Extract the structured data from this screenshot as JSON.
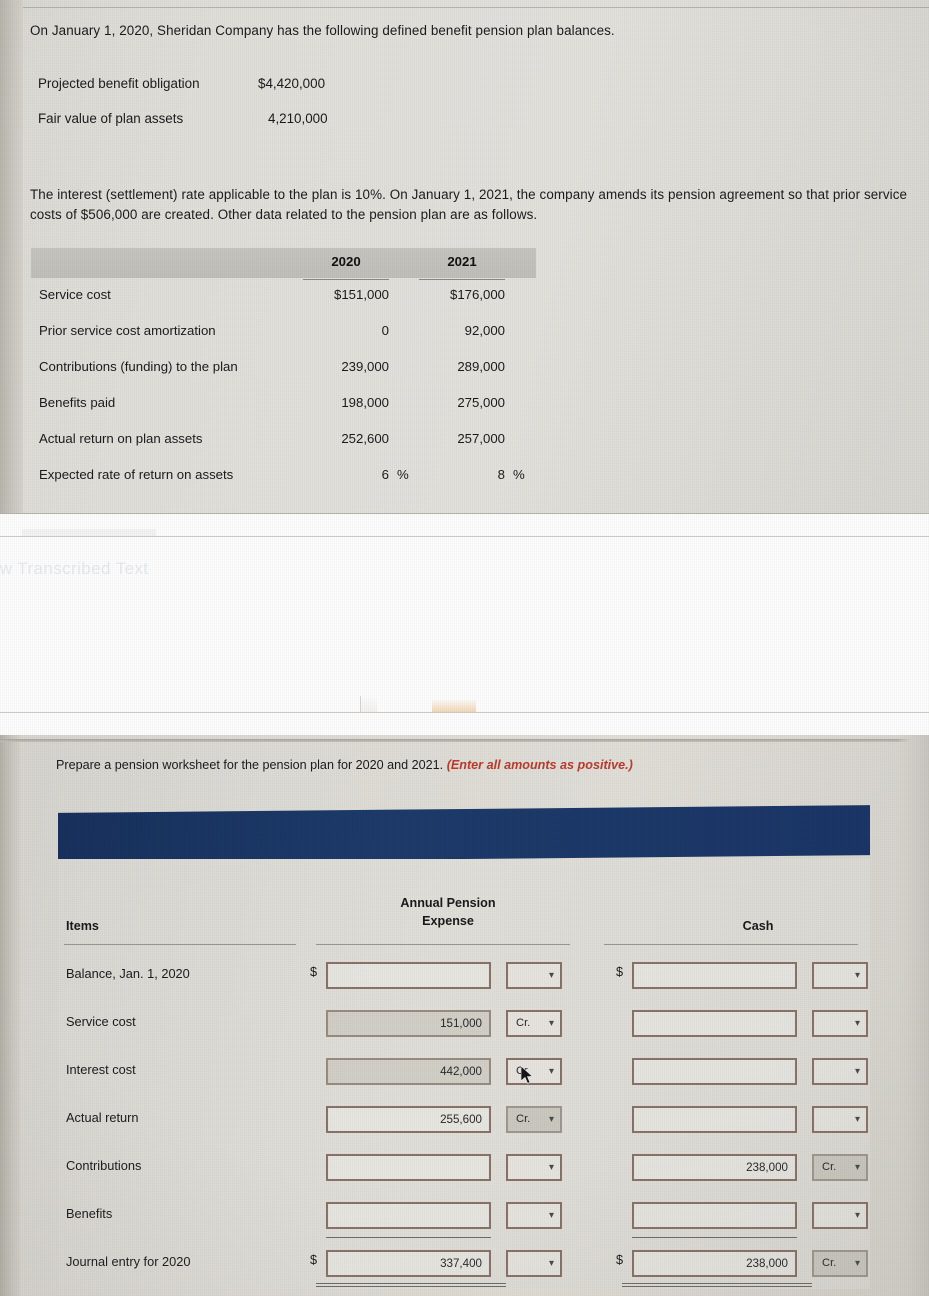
{
  "problem": {
    "intro": "On January 1, 2020, Sheridan Company has the following defined benefit pension plan balances.",
    "balances": [
      {
        "label": "Projected benefit obligation",
        "value": "$4,420,000"
      },
      {
        "label": "Fair value of plan assets",
        "value": "4,210,000"
      }
    ],
    "interest_paragraph": "The interest (settlement) rate applicable to the plan is 10%. On January 1, 2021, the company amends its pension agreement so that prior service costs of $506,000 are created. Other data related to the pension plan are as follows."
  },
  "data_table": {
    "columns": [
      "2020",
      "2021"
    ],
    "rows": [
      {
        "label": "Service cost",
        "v2020": "$151,000",
        "v2021": "$176,000",
        "suffix2020": "",
        "suffix2021": ""
      },
      {
        "label": "Prior service cost amortization",
        "v2020": "0",
        "v2021": "92,000",
        "suffix2020": "",
        "suffix2021": ""
      },
      {
        "label": "Contributions (funding) to the plan",
        "v2020": "239,000",
        "v2021": "289,000",
        "suffix2020": "",
        "suffix2021": ""
      },
      {
        "label": "Benefits paid",
        "v2020": "198,000",
        "v2021": "275,000",
        "suffix2020": "",
        "suffix2021": ""
      },
      {
        "label": "Actual return on plan assets",
        "v2020": "252,600",
        "v2021": "257,000",
        "suffix2020": "",
        "suffix2021": ""
      },
      {
        "label": "Expected rate of return on assets",
        "v2020": "6",
        "v2021": "8",
        "suffix2020": "%",
        "suffix2021": "%"
      }
    ]
  },
  "gap": {
    "ghost_text": "ow Transcribed Text"
  },
  "worksheet": {
    "prompt_main": "Prepare a pension worksheet for the pension plan for 2020 and 2021.",
    "prompt_emphasis": "(Enter all amounts as positive.)",
    "banner_color": "#1a3668",
    "headers": {
      "items": "Items",
      "annual_pension_expense": "Annual Pension\nExpense",
      "annual_pension_expense_line1": "Annual Pension",
      "annual_pension_expense_line2": "Expense",
      "cash": "Cash"
    },
    "dropdown_value": "Cr.",
    "dollar_sign": "$",
    "rows": [
      {
        "label": "Balance, Jan. 1, 2020",
        "ape_dollar": "$",
        "ape_value": "",
        "ape_select": "",
        "ape_shaded": false,
        "ape_select_shaded": false,
        "cash_dollar": "$",
        "cash_value": "",
        "cash_select": "",
        "cash_shaded": false,
        "cash_select_shaded": false
      },
      {
        "label": "Service cost",
        "ape_dollar": "",
        "ape_value": "151,000",
        "ape_select": "Cr.",
        "ape_shaded": true,
        "ape_select_shaded": false,
        "cash_dollar": "",
        "cash_value": "",
        "cash_select": "",
        "cash_shaded": false,
        "cash_select_shaded": false
      },
      {
        "label": "Interest cost",
        "ape_dollar": "",
        "ape_value": "442,000",
        "ape_select": "Cr.",
        "ape_shaded": true,
        "ape_select_shaded": false,
        "cash_dollar": "",
        "cash_value": "",
        "cash_select": "",
        "cash_shaded": false,
        "cash_select_shaded": false
      },
      {
        "label": "Actual return",
        "ape_dollar": "",
        "ape_value": "255,600",
        "ape_select": "Cr.",
        "ape_shaded": false,
        "ape_select_shaded": true,
        "cash_dollar": "",
        "cash_value": "",
        "cash_select": "",
        "cash_shaded": false,
        "cash_select_shaded": false
      },
      {
        "label": "Contributions",
        "ape_dollar": "",
        "ape_value": "",
        "ape_select": "",
        "ape_shaded": false,
        "ape_select_shaded": false,
        "cash_dollar": "",
        "cash_value": "238,000",
        "cash_select": "Cr.",
        "cash_shaded": false,
        "cash_select_shaded": true
      },
      {
        "label": "Benefits",
        "ape_dollar": "",
        "ape_value": "",
        "ape_select": "",
        "ape_shaded": false,
        "ape_select_shaded": false,
        "cash_dollar": "",
        "cash_value": "",
        "cash_select": "",
        "cash_shaded": false,
        "cash_select_shaded": false
      },
      {
        "label": "Journal entry for 2020",
        "ape_dollar": "$",
        "ape_value": "337,400",
        "ape_select": "",
        "ape_shaded": false,
        "ape_select_shaded": false,
        "cash_dollar": "$",
        "cash_value": "238,000",
        "cash_select": "Cr.",
        "cash_shaded": false,
        "cash_select_shaded": true
      }
    ]
  }
}
